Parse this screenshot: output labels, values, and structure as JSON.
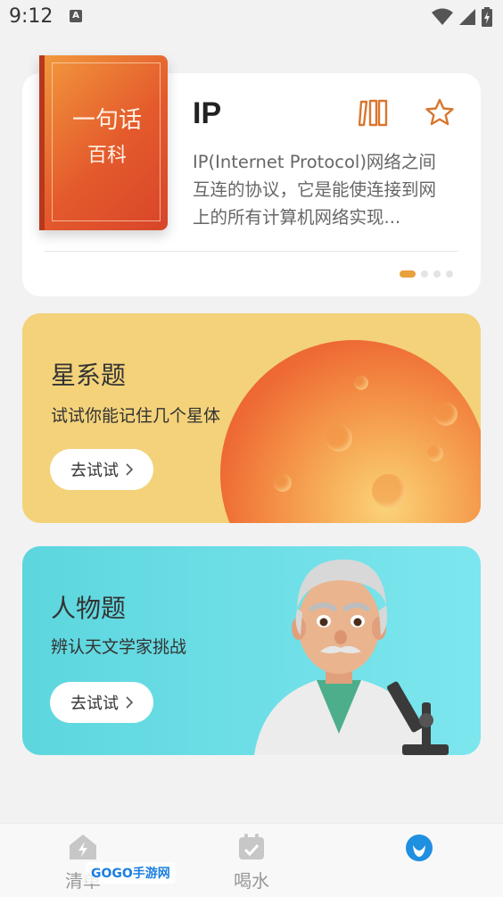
{
  "status_bar": {
    "time": "9:12",
    "notif_letter": "A"
  },
  "card_encyclopedia": {
    "book_title_line1": "一句话",
    "book_title_line2": "百科",
    "title": "IP",
    "description": "IP(Internet Protocol)网络之间互连的协议，它是能使连接到网上的所有计算机网络实现...",
    "page_indicator": {
      "current": 1,
      "total": 4
    },
    "accent": "#e9a13b"
  },
  "card_stars": {
    "title": "星系题",
    "subtitle": "试试你能记住几个星体",
    "button_label": "去试试",
    "background": "#f3d27a"
  },
  "card_people": {
    "title": "人物题",
    "subtitle": "辨认天文学家挑战",
    "button_label": "去试试",
    "background": "#6fe0e8"
  },
  "bottom_nav": {
    "items": [
      {
        "label": "清单",
        "icon": "lightning-house-icon"
      },
      {
        "label": "喝水",
        "icon": "calendar-check-icon"
      },
      {
        "label": "",
        "icon": "leaf-drop-icon"
      }
    ]
  },
  "watermark": {
    "text": "GOGO手游网"
  }
}
